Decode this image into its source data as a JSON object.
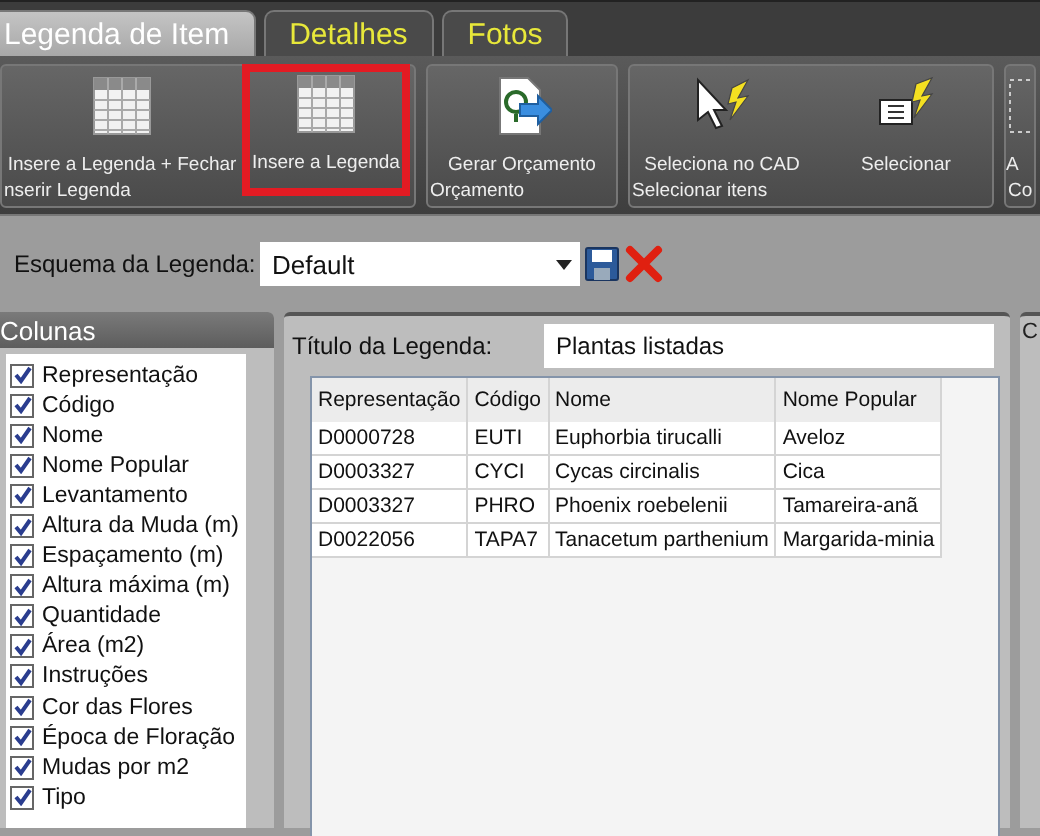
{
  "tabs": [
    {
      "label": "Legenda de Item",
      "selected": true
    },
    {
      "label": "Detalhes",
      "selected": false
    },
    {
      "label": "Fotos",
      "selected": false
    }
  ],
  "ribbon_groups": [
    {
      "label": "nserir Legenda",
      "buttons": [
        {
          "label": "Insere a Legenda + Fechar",
          "kind": "table",
          "highlighted": false
        },
        {
          "label": "Insere a Legenda",
          "kind": "table",
          "highlighted": true
        }
      ]
    },
    {
      "label": "Orçamento",
      "buttons": [
        {
          "label": "Gerar Orçamento",
          "kind": "budget",
          "highlighted": false
        }
      ]
    },
    {
      "label": "Selecionar itens",
      "buttons": [
        {
          "label": "Seleciona no CAD",
          "kind": "cursor",
          "highlighted": false
        },
        {
          "label": "Selecionar",
          "kind": "text-select",
          "highlighted": false
        }
      ]
    },
    {
      "label": "Co",
      "buttons": [
        {
          "label": "A",
          "kind": "frame",
          "highlighted": false
        }
      ]
    }
  ],
  "scheme": {
    "label": "Esquema da Legenda:",
    "value": "Default"
  },
  "columns_panel": {
    "title": "Colunas",
    "items": [
      {
        "label": "Representação",
        "checked": true
      },
      {
        "label": "Código",
        "checked": true
      },
      {
        "label": "Nome",
        "checked": true
      },
      {
        "label": "Nome Popular",
        "checked": true
      },
      {
        "label": "Levantamento",
        "checked": true
      },
      {
        "label": "Altura da Muda (m)",
        "checked": true
      },
      {
        "label": "Espaçamento (m)",
        "checked": true
      },
      {
        "label": "Altura máxima (m)",
        "checked": true
      },
      {
        "label": "Quantidade",
        "checked": true
      },
      {
        "label": "Área (m2)",
        "checked": true
      },
      {
        "label": "Instruções",
        "checked": true
      },
      {
        "label": "Cor das Flores",
        "checked": true
      },
      {
        "label": "Época de Floração",
        "checked": true
      },
      {
        "label": "Mudas por m2",
        "checked": true
      },
      {
        "label": "Tipo",
        "checked": true
      }
    ]
  },
  "legend_title": {
    "label": "Título da Legenda:",
    "value": "Plantas listadas"
  },
  "table": {
    "columns": [
      "Representação",
      "Código",
      "Nome",
      "Nome Popular"
    ],
    "rows": [
      [
        "D0000728",
        "EUTI",
        "Euphorbia tirucalli",
        "Aveloz"
      ],
      [
        "D0003327",
        "CYCI",
        "Cycas circinalis",
        "Cica"
      ],
      [
        "D0003327",
        "PHRO",
        "Phoenix roebelenii",
        "Tamareira-anã"
      ],
      [
        "D0022056",
        "TAPA7",
        "Tanacetum parthenium",
        "Margarida-minia"
      ]
    ]
  },
  "right_panel": {
    "title": "C"
  }
}
